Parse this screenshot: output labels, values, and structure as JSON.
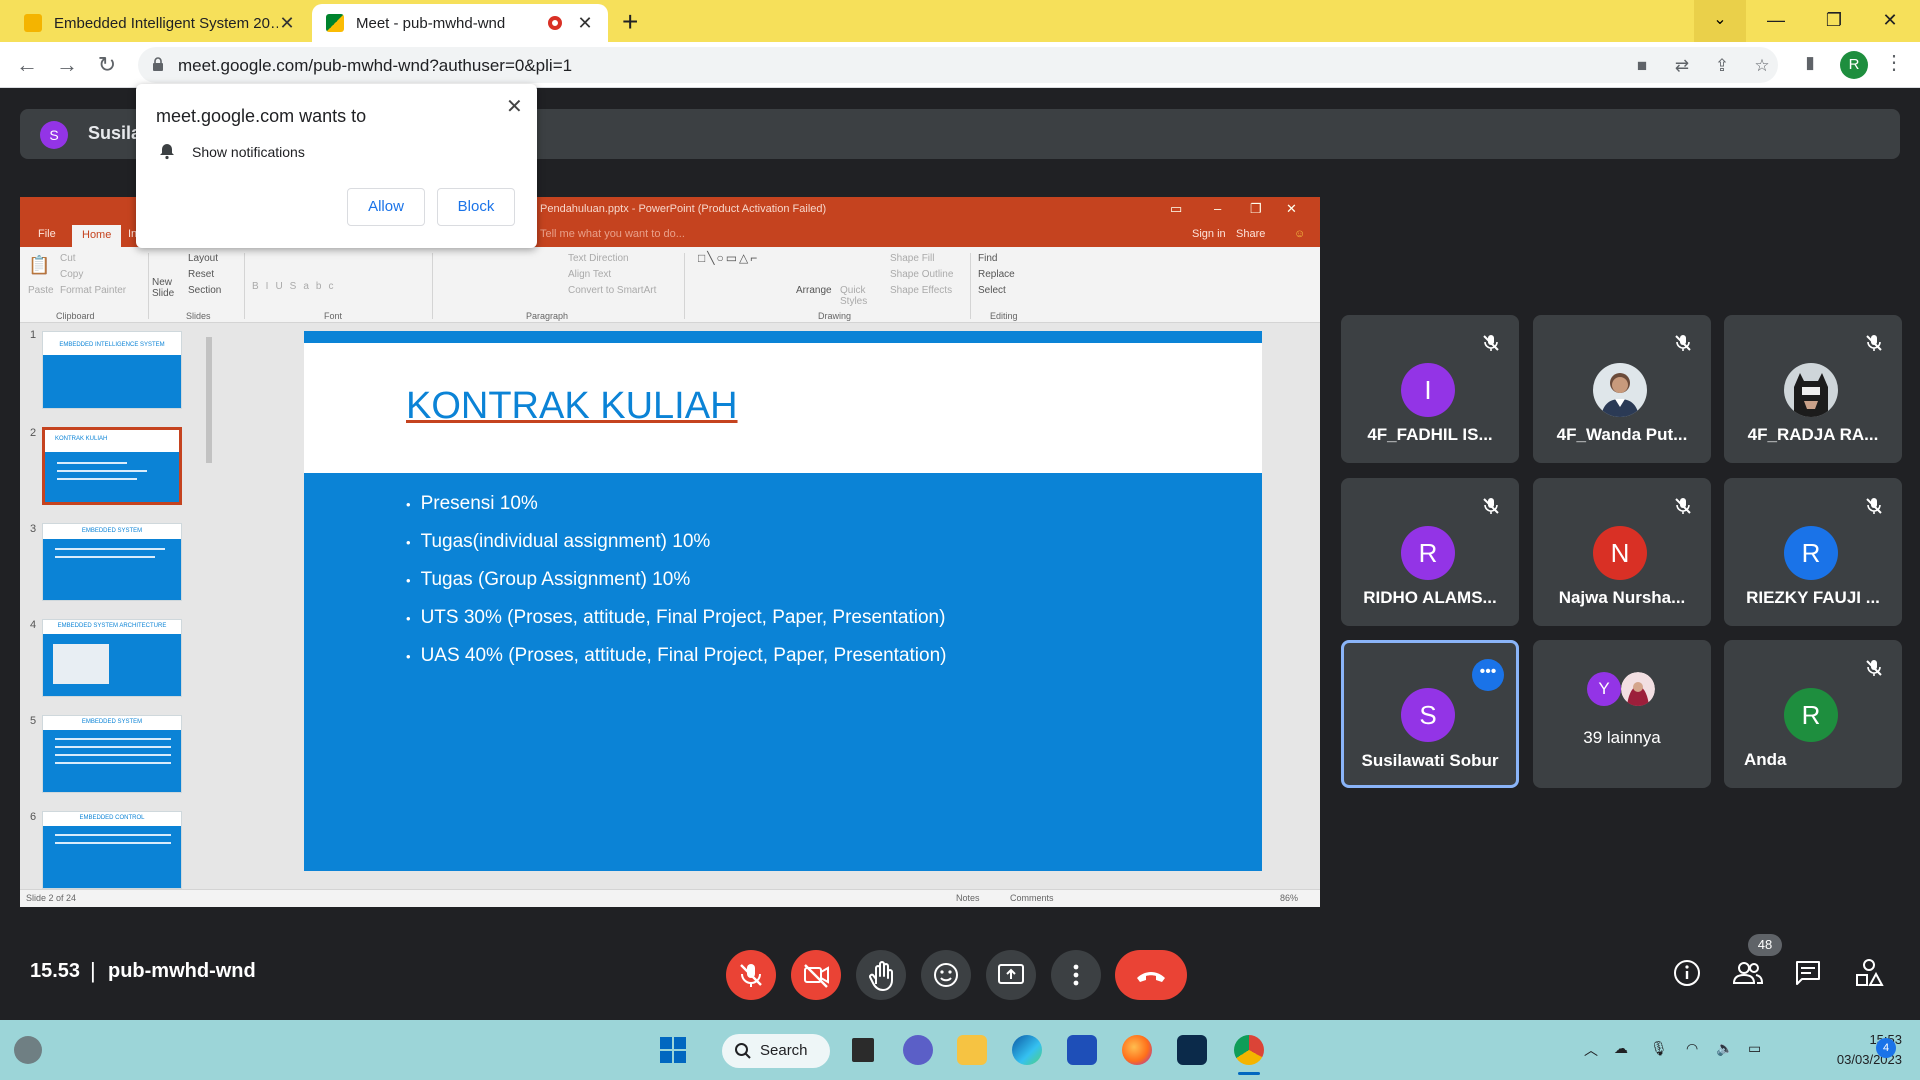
{
  "browser": {
    "tabs": [
      {
        "title": "Embedded Intelligent System 20…",
        "active": false
      },
      {
        "title": "Meet - pub-mwhd-wnd",
        "active": true
      }
    ],
    "url": "meet.google.com/pub-mwhd-wnd?authuser=0&pli=1",
    "profile_initial": "R"
  },
  "permission_popup": {
    "title": "meet.google.com wants to",
    "permission": "Show notifications",
    "allow_label": "Allow",
    "block_label": "Block"
  },
  "presenter": {
    "initial": "S",
    "name": "Susila"
  },
  "powerpoint": {
    "window_title": "Pendahuluan.pptx - PowerPoint (Product Activation Failed)",
    "tabs": [
      "File",
      "Home",
      "In"
    ],
    "tell_me": "Tell me what you want to do...",
    "sign_in": "Sign in",
    "share": "Share",
    "ribbon": {
      "clipboard": "Clipboard",
      "slides": "Slides",
      "font": "Font",
      "paragraph": "Paragraph",
      "drawing": "Drawing",
      "editing": "Editing",
      "paste": "Paste",
      "cut": "Cut",
      "copy": "Copy",
      "format_painter": "Format Painter",
      "new_slide": "New Slide",
      "layout": "Layout",
      "reset": "Reset",
      "section": "Section",
      "text_direction": "Text Direction",
      "align_text": "Align Text",
      "convert_smartart": "Convert to SmartArt",
      "arrange": "Arrange",
      "quick_styles": "Quick Styles",
      "shape_fill": "Shape Fill",
      "shape_outline": "Shape Outline",
      "shape_effects": "Shape Effects",
      "find": "Find",
      "replace": "Replace",
      "select": "Select"
    },
    "thumbnails": [
      {
        "num": "1",
        "title": "EMBEDDED INTELLIGENCE SYSTEM"
      },
      {
        "num": "2",
        "title": "KONTRAK KULIAH"
      },
      {
        "num": "3",
        "title": "EMBEDDED SYSTEM"
      },
      {
        "num": "4",
        "title": "EMBEDDED SYSTEM ARCHITECTURE"
      },
      {
        "num": "5",
        "title": "EMBEDDED SYSTEM"
      },
      {
        "num": "6",
        "title": "EMBEDDED CONTROL"
      }
    ],
    "slide": {
      "heading": "KONTRAK KULIAH",
      "bullets": [
        "Presensi 10%",
        "Tugas(individual assignment) 10%",
        "Tugas (Group Assignment) 10%",
        "UTS 30% (Proses, attitude, Final Project, Paper, Presentation)",
        "UAS 40% (Proses, attitude, Final Project, Paper, Presentation)"
      ]
    },
    "status": {
      "slide_of": "Slide 2 of 24",
      "notes": "Notes",
      "comments": "Comments",
      "zoom": "86%"
    }
  },
  "participants": [
    {
      "name": "4F_FADHIL IS...",
      "initial": "I",
      "color": "#9334e6",
      "muted": true,
      "photo": false
    },
    {
      "name": "4F_Wanda Put...",
      "initial": "",
      "color": "#ffffff",
      "muted": true,
      "photo": true
    },
    {
      "name": "4F_RADJA RA...",
      "initial": "",
      "color": "#ffffff",
      "muted": true,
      "photo": true
    },
    {
      "name": "RIDHO ALAMS...",
      "initial": "R",
      "color": "#9334e6",
      "muted": true,
      "photo": false
    },
    {
      "name": "Najwa Nursha...",
      "initial": "N",
      "color": "#d93025",
      "muted": true,
      "photo": false
    },
    {
      "name": "RIEZKY FAUJI ...",
      "initial": "R",
      "color": "#1a73e8",
      "muted": true,
      "photo": false
    },
    {
      "name": "Susilawati Sobur",
      "initial": "S",
      "color": "#9334e6",
      "muted": false,
      "photo": false
    },
    {
      "name": "39 lainnya",
      "initial": "Y",
      "color": "#9334e6",
      "muted": false,
      "photo": false
    },
    {
      "name": "Anda",
      "initial": "R",
      "color": "#1e8e3e",
      "muted": true,
      "photo": false
    }
  ],
  "meeting": {
    "time": "15.53",
    "separator": "|",
    "code": "pub-mwhd-wnd",
    "participant_count": "48"
  },
  "taskbar": {
    "search_label": "Search",
    "time": "15:53",
    "date": "03/03/2023",
    "notification_count": "4"
  }
}
